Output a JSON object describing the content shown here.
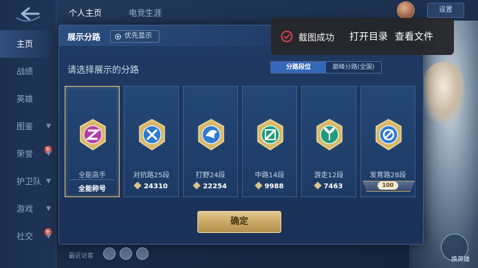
{
  "top_tabs": [
    "个人主页",
    "电竞生涯"
  ],
  "top_right": {
    "settings_label": "设置"
  },
  "nav": [
    {
      "label": "主页",
      "active": true
    },
    {
      "label": "战绩"
    },
    {
      "label": "英雄"
    },
    {
      "label": "图鉴",
      "chevron": true
    },
    {
      "label": "荣誉",
      "chevron": true,
      "badge": "新"
    },
    {
      "label": "护卫队",
      "chevron": true
    },
    {
      "label": "游戏",
      "chevron": true
    },
    {
      "label": "社交",
      "chevron": true,
      "badge": "新"
    }
  ],
  "toast": {
    "message": "截图成功",
    "open_dir": "打开目录",
    "view_file": "查看文件",
    "icon": "check-circle-icon",
    "icon_color": "#e5484d"
  },
  "dialog": {
    "title": "展示分路",
    "priority_label": "优先显示",
    "subtitle": "请选择展示的分路",
    "tabs": [
      {
        "label": "分路段位",
        "active": true
      },
      {
        "label": "巅峰分路(全国)"
      }
    ],
    "confirm_label": "确定"
  },
  "lanes": [
    {
      "name": "全能高手",
      "title_label": "全能称号",
      "icon": "all-rounder-icon",
      "selected": true
    },
    {
      "name": "对抗路25段",
      "score": "24310",
      "icon": "clash-lane-icon"
    },
    {
      "name": "打野24段",
      "score": "22254",
      "icon": "jungle-icon"
    },
    {
      "name": "中路14段",
      "score": "9988",
      "icon": "mid-lane-icon"
    },
    {
      "name": "游走12段",
      "score": "7463",
      "icon": "roam-icon"
    },
    {
      "name": "发育路28段",
      "ribbon_value": "100",
      "icon": "farm-lane-icon"
    }
  ],
  "bottom": {
    "visitors_label": "最近访客"
  },
  "hero_panel": {
    "change_label": "换英雄"
  },
  "colors": {
    "accent_gold": "#e3c47a",
    "active_tab": "#3468b8",
    "panel_bg": "#1f3a63"
  }
}
